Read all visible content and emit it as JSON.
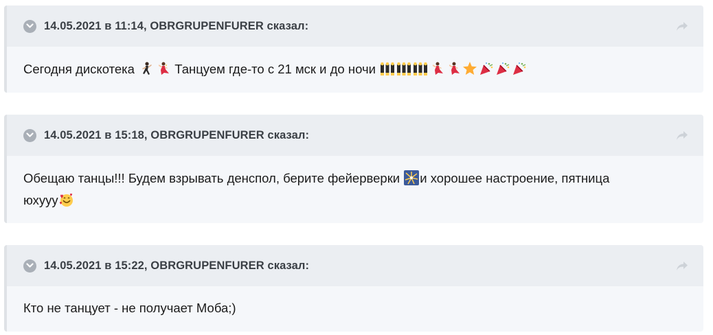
{
  "quotes": [
    {
      "cite": "14.05.2021 в 11:14, OBRGRUPENFURER сказал:",
      "text_before": "Сегодня дискотека ",
      "text_middle": " Танцуем где-то с 21 мск и до ночи ",
      "emoji_icons_1": [
        "man-dancing-icon",
        "woman-dancing-icon"
      ],
      "emoji_icons_2": [
        "dancers-icon",
        "dancers-icon",
        "dancers-icon",
        "woman-dancing-icon",
        "woman-dancing-icon",
        "star-icon",
        "party-popper-icon",
        "party-popper-icon",
        "party-popper-icon"
      ]
    },
    {
      "cite": "14.05.2021 в 15:18, OBRGRUPENFURER сказал:",
      "text_before": "Обещаю танцы!!! Будем взрывать денспол, берите фейерверки ",
      "text_after": "и хорошее настроение, пятница",
      "text_line2": "юхууу",
      "emoji_icons_1": [
        "fireworks-icon"
      ],
      "emoji_icons_2": [
        "smiling-face-with-hearts-icon"
      ]
    },
    {
      "cite": "14.05.2021 в 15:22, OBRGRUPENFURER сказал:",
      "text": "Кто не танцует - не получает Моба;)"
    }
  ],
  "colors": {
    "quote_bg": "#f5f7fa",
    "quote_header_bg": "#ebeef2",
    "quote_border": "#dfe2e6",
    "toggle_icon": "#a9afb7",
    "share_icon": "#cdd2d8"
  }
}
